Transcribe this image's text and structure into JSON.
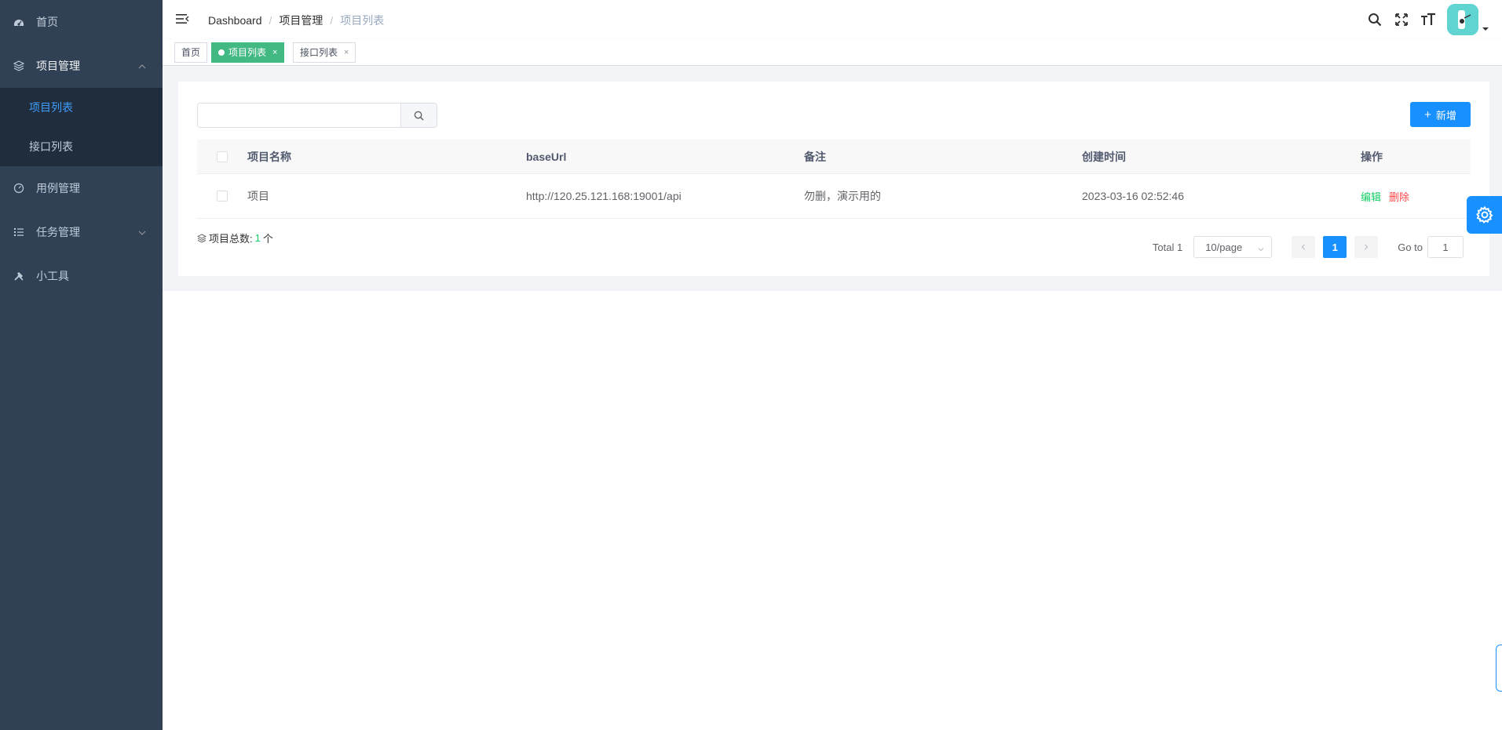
{
  "sidebar": {
    "items": [
      {
        "label": "首页",
        "icon": "dashboard-icon"
      },
      {
        "label": "项目管理",
        "icon": "layers-icon",
        "expanded": true,
        "children": [
          {
            "label": "项目列表",
            "active": true
          },
          {
            "label": "接口列表",
            "active": false
          }
        ]
      },
      {
        "label": "用例管理",
        "icon": "case-icon"
      },
      {
        "label": "任务管理",
        "icon": "list-icon",
        "expanded": false
      },
      {
        "label": "小工具",
        "icon": "tools-icon"
      }
    ]
  },
  "navbar": {
    "breadcrumb": [
      "Dashboard",
      "项目管理",
      "项目列表"
    ],
    "breadcrumb_sep": "/"
  },
  "tags": [
    {
      "label": "首页",
      "active": false,
      "closable": false
    },
    {
      "label": "项目列表",
      "active": true,
      "closable": true
    },
    {
      "label": "接口列表",
      "active": false,
      "closable": true
    }
  ],
  "tag_close": "×",
  "toolbar": {
    "search_placeholder": "",
    "search_value": "",
    "add_label": "新增",
    "add_icon": "+"
  },
  "table": {
    "columns": [
      "项目名称",
      "baseUrl",
      "备注",
      "创建时间",
      "操作"
    ],
    "rows": [
      {
        "name": "项目",
        "baseUrl": "http://120.25.121.168:19001/api",
        "note": "勿删，演示用的",
        "created": "2023-03-16 02:52:46",
        "edit": "编辑",
        "delete": "删除"
      }
    ]
  },
  "summary": {
    "label": "项目总数:",
    "count": "1",
    "unit": "个"
  },
  "pagination": {
    "total_text": "Total 1",
    "page_size": "10/page",
    "current_page": "1",
    "goto_label": "Go to",
    "goto_value": "1"
  },
  "colors": {
    "sidebar_bg": "#304156",
    "submenu_bg": "#1f2d3d",
    "active_menu": "#409eff",
    "tag_active": "#42b983",
    "primary": "#1890ff",
    "edit": "#13ce66",
    "delete": "#ff4949"
  }
}
